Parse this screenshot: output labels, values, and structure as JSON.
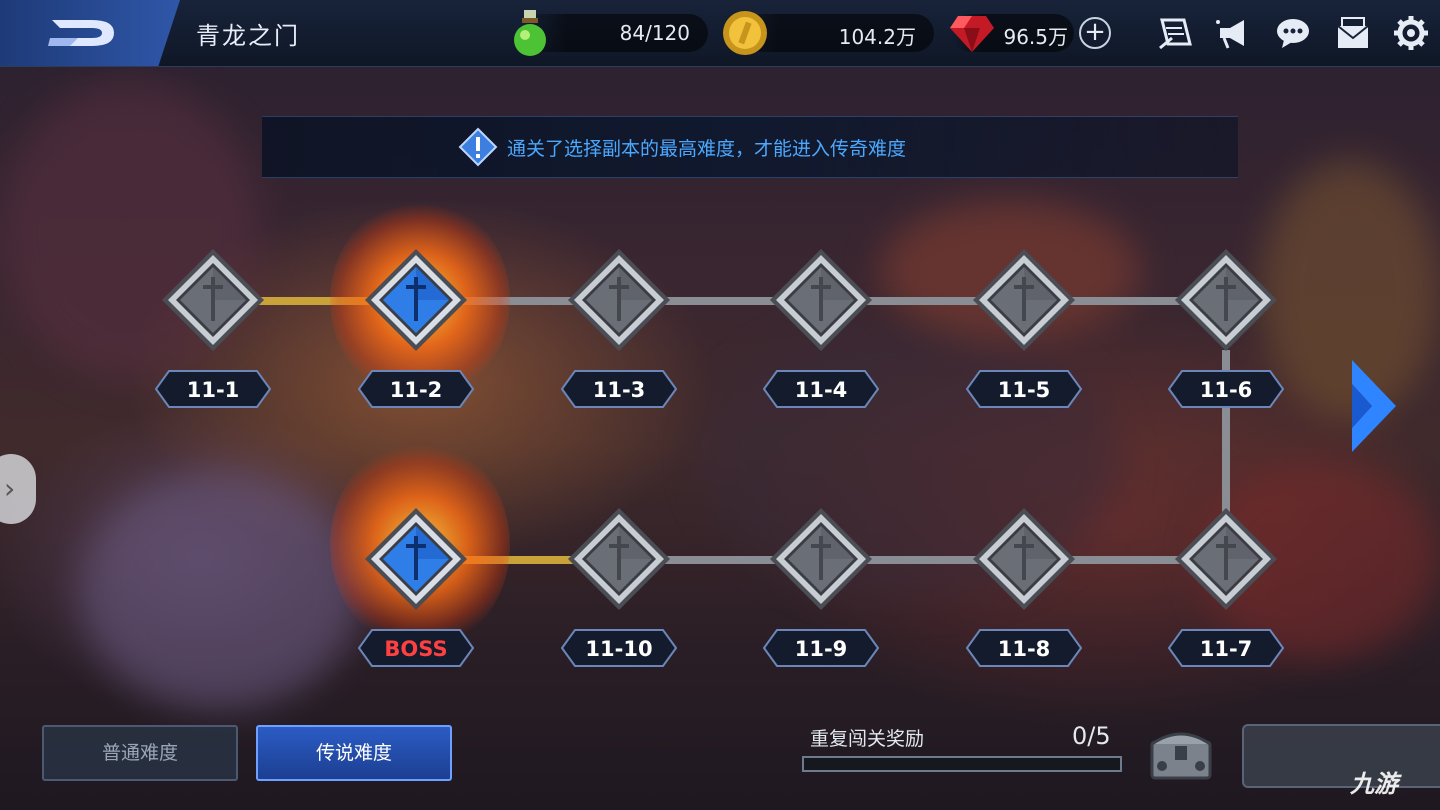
{
  "header": {
    "title": "青龙之门",
    "stamina": "84/120",
    "gold": "104.2万",
    "gems": "96.5万",
    "plus": "+"
  },
  "notice": {
    "text": "通关了选择副本的最高难度，才能进入传奇难度"
  },
  "stages": {
    "top": [
      "11-1",
      "11-2",
      "11-3",
      "11-4",
      "11-5",
      "11-6"
    ],
    "bottom": [
      "BOSS",
      "11-10",
      "11-9",
      "11-8",
      "11-7"
    ]
  },
  "difficulty": {
    "normal": "普通难度",
    "legend": "传说难度"
  },
  "reward": {
    "label": "重复闯关奖励",
    "count": "0/5",
    "progress": 0
  },
  "watermark": "九游",
  "colors": {
    "accent": "#4aa8ff",
    "boss": "#ff4040",
    "gold_path": "#c9a23a"
  }
}
